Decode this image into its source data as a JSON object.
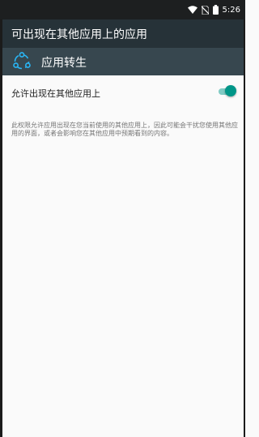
{
  "status_bar": {
    "time": "5:26",
    "icons": [
      "wifi-icon",
      "no-sim-icon",
      "battery-icon"
    ]
  },
  "toolbar": {
    "title": "可出现在其他应用上的应用"
  },
  "app_header": {
    "icon": "share-icon",
    "name": "应用转生"
  },
  "setting": {
    "label": "允许出现在其他应用上",
    "enabled": true,
    "description": "此权限允许应用出现在您当前使用的其他应用上，因此可能会干扰您使用其他应用的界面，或者会影响您在其他应用中预期看到的内容。"
  },
  "colors": {
    "status_bar": "#1d1f20",
    "toolbar": "#263238",
    "app_header": "#37474f",
    "accent": "#009688",
    "accent_light": "#80cbc4",
    "background": "#fafafa"
  }
}
